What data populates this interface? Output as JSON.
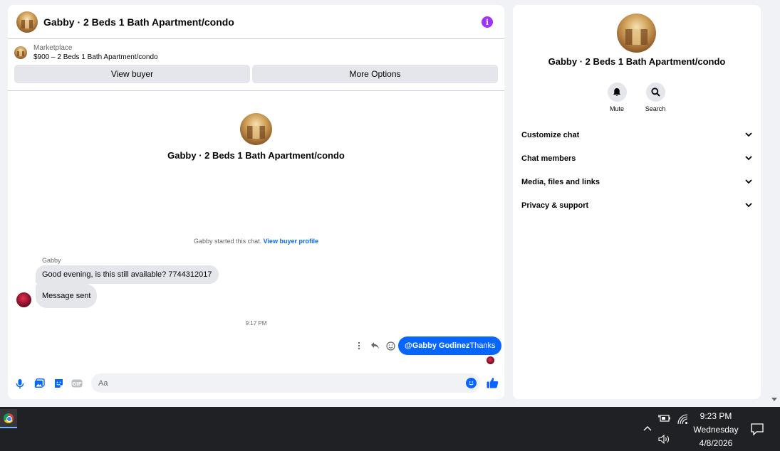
{
  "header": {
    "title": "Gabby · 2 Beds 1 Bath Apartment/condo",
    "info_icon": "i"
  },
  "marketplace": {
    "label": "Marketplace",
    "item": "$900 – 2 Beds 1 Bath Apartment/condo",
    "view_buyer": "View buyer",
    "more_options": "More Options"
  },
  "intro": {
    "title": "Gabby · 2 Beds 1 Bath Apartment/condo"
  },
  "thread": {
    "started_text": "Gabby started this chat.",
    "started_link": "View buyer profile",
    "sender_name": "Gabby",
    "messages_in": [
      "Good evening, is this still available? 7744312017",
      "Message sent"
    ],
    "time": "9:17 PM",
    "out_mention": "@Gabby Godinez",
    "out_text": "Thanks"
  },
  "composer": {
    "placeholder": "Aa"
  },
  "info_panel": {
    "title": "Gabby · 2 Beds 1 Bath Apartment/condo",
    "mute": "Mute",
    "search": "Search",
    "menu": [
      "Customize chat",
      "Chat members",
      "Media, files and links",
      "Privacy & support"
    ]
  },
  "taskbar": {
    "time": "9:23 PM",
    "day": "Wednesday",
    "date": "4/8/2026"
  },
  "colors": {
    "accent": "#0866ff",
    "info_purple": "#a033ff",
    "bubble_gray": "#e4e6eb",
    "taskbar": "#202124"
  }
}
